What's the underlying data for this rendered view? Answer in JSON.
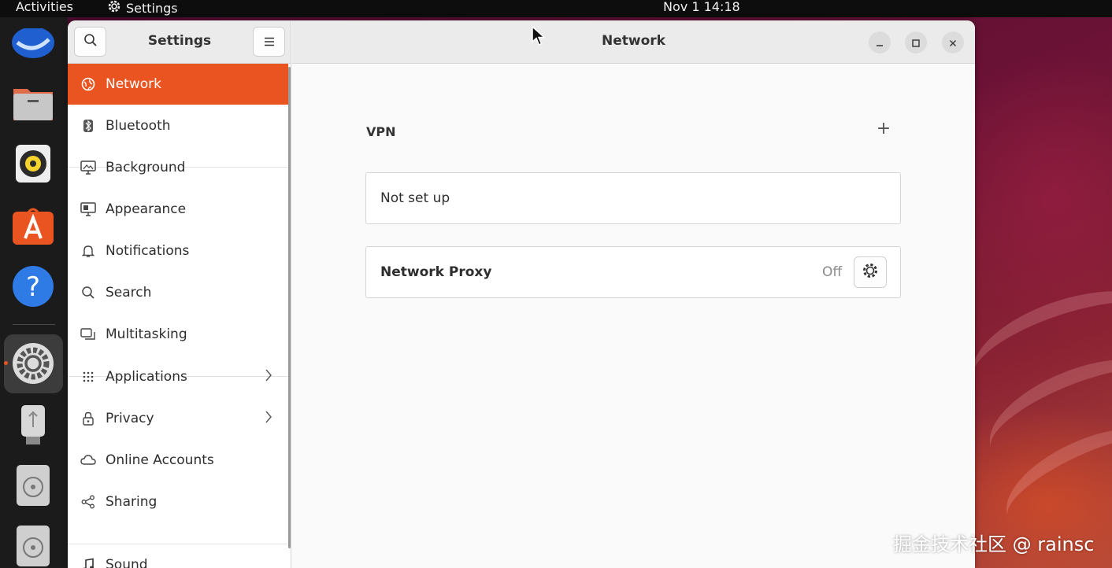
{
  "topbar": {
    "activities": "Activities",
    "app_name": "Settings",
    "clock": "Nov 1  14:18"
  },
  "dock": {
    "items": [
      "thunderbird-icon",
      "files-icon",
      "rhythmbox-icon",
      "app-center-icon",
      "help-icon",
      "settings-icon",
      "usb-drive-icon",
      "disc-icon",
      "disc-icon"
    ],
    "active": "settings-icon"
  },
  "sidebar": {
    "title": "Settings",
    "items": [
      {
        "label": "Network",
        "icon": "network-icon",
        "active": true
      },
      {
        "label": "Bluetooth",
        "icon": "bluetooth-icon"
      },
      {
        "label": "Background",
        "icon": "background-icon"
      },
      {
        "label": "Appearance",
        "icon": "appearance-icon"
      },
      {
        "label": "Notifications",
        "icon": "bell-icon"
      },
      {
        "label": "Search",
        "icon": "search-icon"
      },
      {
        "label": "Multitasking",
        "icon": "multitasking-icon"
      },
      {
        "label": "Applications",
        "icon": "apps-grid-icon",
        "has_submenu": true
      },
      {
        "label": "Privacy",
        "icon": "lock-icon",
        "has_submenu": true
      },
      {
        "label": "Online Accounts",
        "icon": "cloud-icon"
      },
      {
        "label": "Sharing",
        "icon": "share-icon"
      },
      {
        "label": "Sound",
        "icon": "music-note-icon"
      }
    ]
  },
  "main": {
    "title": "Network",
    "vpn": {
      "heading": "VPN",
      "add_symbol": "+",
      "status": "Not set up"
    },
    "proxy": {
      "label": "Network Proxy",
      "state": "Off"
    }
  },
  "watermark": "掘金技术社区 @ rainsc",
  "colors": {
    "accent": "#e95420",
    "topbar": "#0d0d0d",
    "dock": "#1b1b1b"
  }
}
